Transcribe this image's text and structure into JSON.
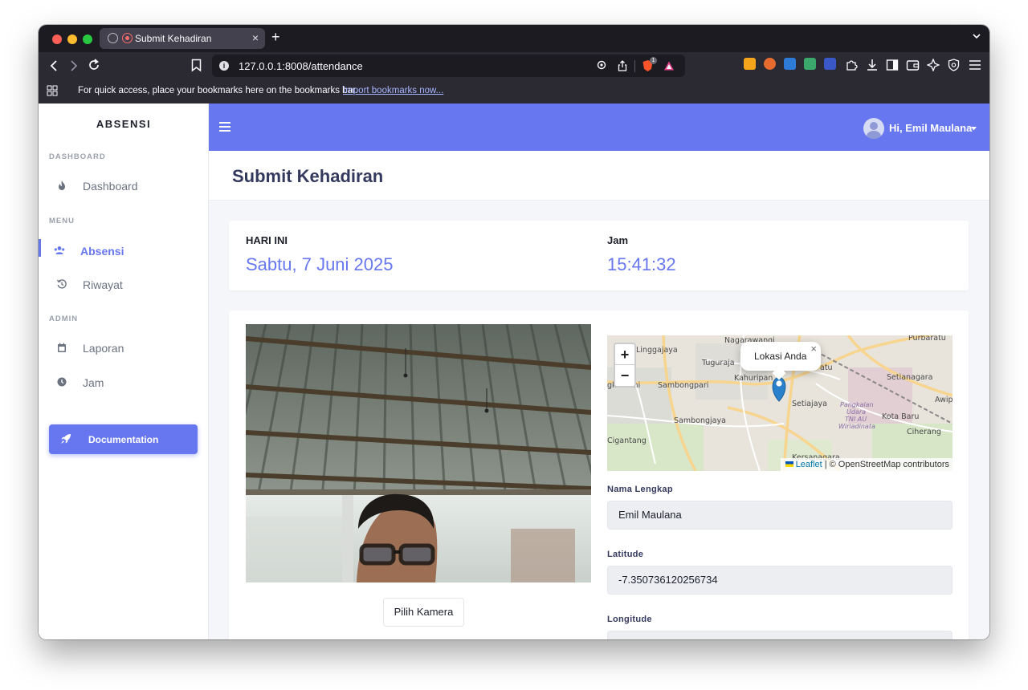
{
  "browser": {
    "tab_title": "Submit Kehadiran",
    "tab_close": "×",
    "new_tab": "+",
    "url": "127.0.0.1:8008/attendance",
    "brave_badge": "1",
    "bookmarks_text": "For quick access, place your bookmarks here on the bookmarks bar.",
    "bookmarks_link": "Import bookmarks now..."
  },
  "sidebar": {
    "brand": "ABSENSI",
    "sections": {
      "dashboard": "DASHBOARD",
      "menu": "MENU",
      "admin": "ADMIN"
    },
    "items": [
      {
        "label": "Dashboard",
        "icon": "fire-icon"
      },
      {
        "label": "Absensi",
        "icon": "users-icon",
        "active": true
      },
      {
        "label": "Riwayat",
        "icon": "history-icon"
      },
      {
        "label": "Laporan",
        "icon": "calendar-icon"
      },
      {
        "label": "Jam",
        "icon": "clock-icon"
      }
    ],
    "doc_button": "Documentation"
  },
  "topbar": {
    "greeting": "Hi, Emil Maulana",
    "accent": "#6777ef"
  },
  "page": {
    "title": "Submit Kehadiran"
  },
  "today": {
    "label": "HARI INI",
    "value": "Sabtu, 7 Juni 2025"
  },
  "time": {
    "label": "Jam",
    "value": "15:41:32"
  },
  "camera": {
    "button": "Pilih Kamera"
  },
  "map": {
    "zoom_in": "+",
    "zoom_out": "−",
    "popup": "Lokasi Anda",
    "popup_close": "×",
    "attribution_leaflet": "Leaflet",
    "attribution_rest": "| © OpenStreetMap contributors",
    "places": {
      "nagarawangi": "Nagarawangi",
      "purbaratu": "Purbaratu",
      "linggajaya": "Linggajaya",
      "tuguraja": "Tuguraja",
      "kahuripan": "Kahuripan",
      "setianagara": "Setianagara",
      "gkubumi": "gkubumi",
      "sambongpari": "Sambongpari",
      "setiajaya": "Setiajaya",
      "awipari": "Awipar",
      "sambongjaya": "Sambongjaya",
      "kotabaru": "Kota Baru",
      "pangkalan": "Pangkalan",
      "udara": "Udara",
      "tniau": "TNI AU",
      "wiriadinata": "Wiriadinata",
      "cigantang": "Cigantang",
      "ciherang": "Ciherang",
      "kersanagara": "Kersanagara",
      "atu": "atu"
    }
  },
  "form": {
    "name_label": "Nama Lengkap",
    "name_value": "Emil Maulana",
    "lat_label": "Latitude",
    "lat_value": "-7.350736120256734",
    "lon_label": "Longitude",
    "lon_value": ""
  }
}
